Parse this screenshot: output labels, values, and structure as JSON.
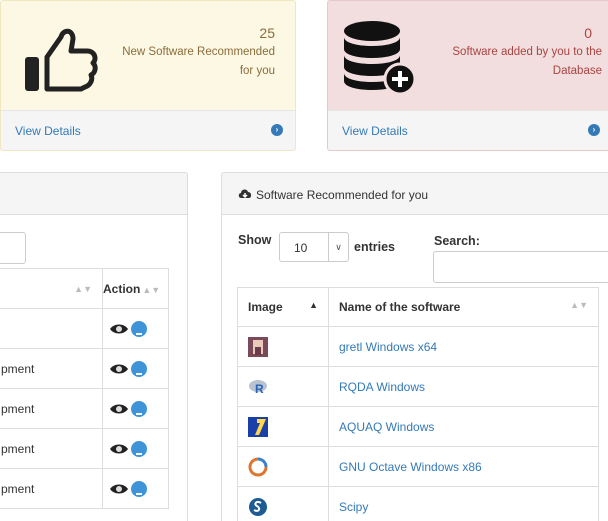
{
  "cards": {
    "recommended": {
      "count": "25",
      "line1": "New Software Recommended",
      "line2": "for you",
      "link": "View Details",
      "bg": "#fcf8e3",
      "color": "#8a6d3b"
    },
    "database": {
      "count": "0",
      "line1": "Software added by you to the",
      "line2": "Database",
      "link": "View Details",
      "bg": "#f2dede",
      "color": "#a94442"
    }
  },
  "left_table": {
    "headers": [
      "",
      "Action"
    ],
    "rows": [
      {
        "name": ""
      },
      {
        "name": "pment"
      },
      {
        "name": "pment"
      },
      {
        "name": "pment"
      },
      {
        "name": "pment"
      }
    ]
  },
  "right_panel": {
    "title": "Software Recommended for you",
    "show_label": "Show",
    "entries_value": "10",
    "entries_label": "entries",
    "search_label": "Search:",
    "search_value": "",
    "table_headers": [
      "Image",
      "Name of the software"
    ],
    "rows": [
      {
        "icon": "gretl-icon",
        "name": "gretl Windows x64"
      },
      {
        "icon": "rqda-icon",
        "name": "RQDA Windows"
      },
      {
        "icon": "aquaq-icon",
        "name": "AQUAQ Windows"
      },
      {
        "icon": "octave-icon",
        "name": "GNU Octave Windows x86"
      },
      {
        "icon": "scipy-icon",
        "name": "Scipy"
      }
    ]
  },
  "colors": {
    "link": "#337ab7",
    "download": "#3d95d8"
  }
}
